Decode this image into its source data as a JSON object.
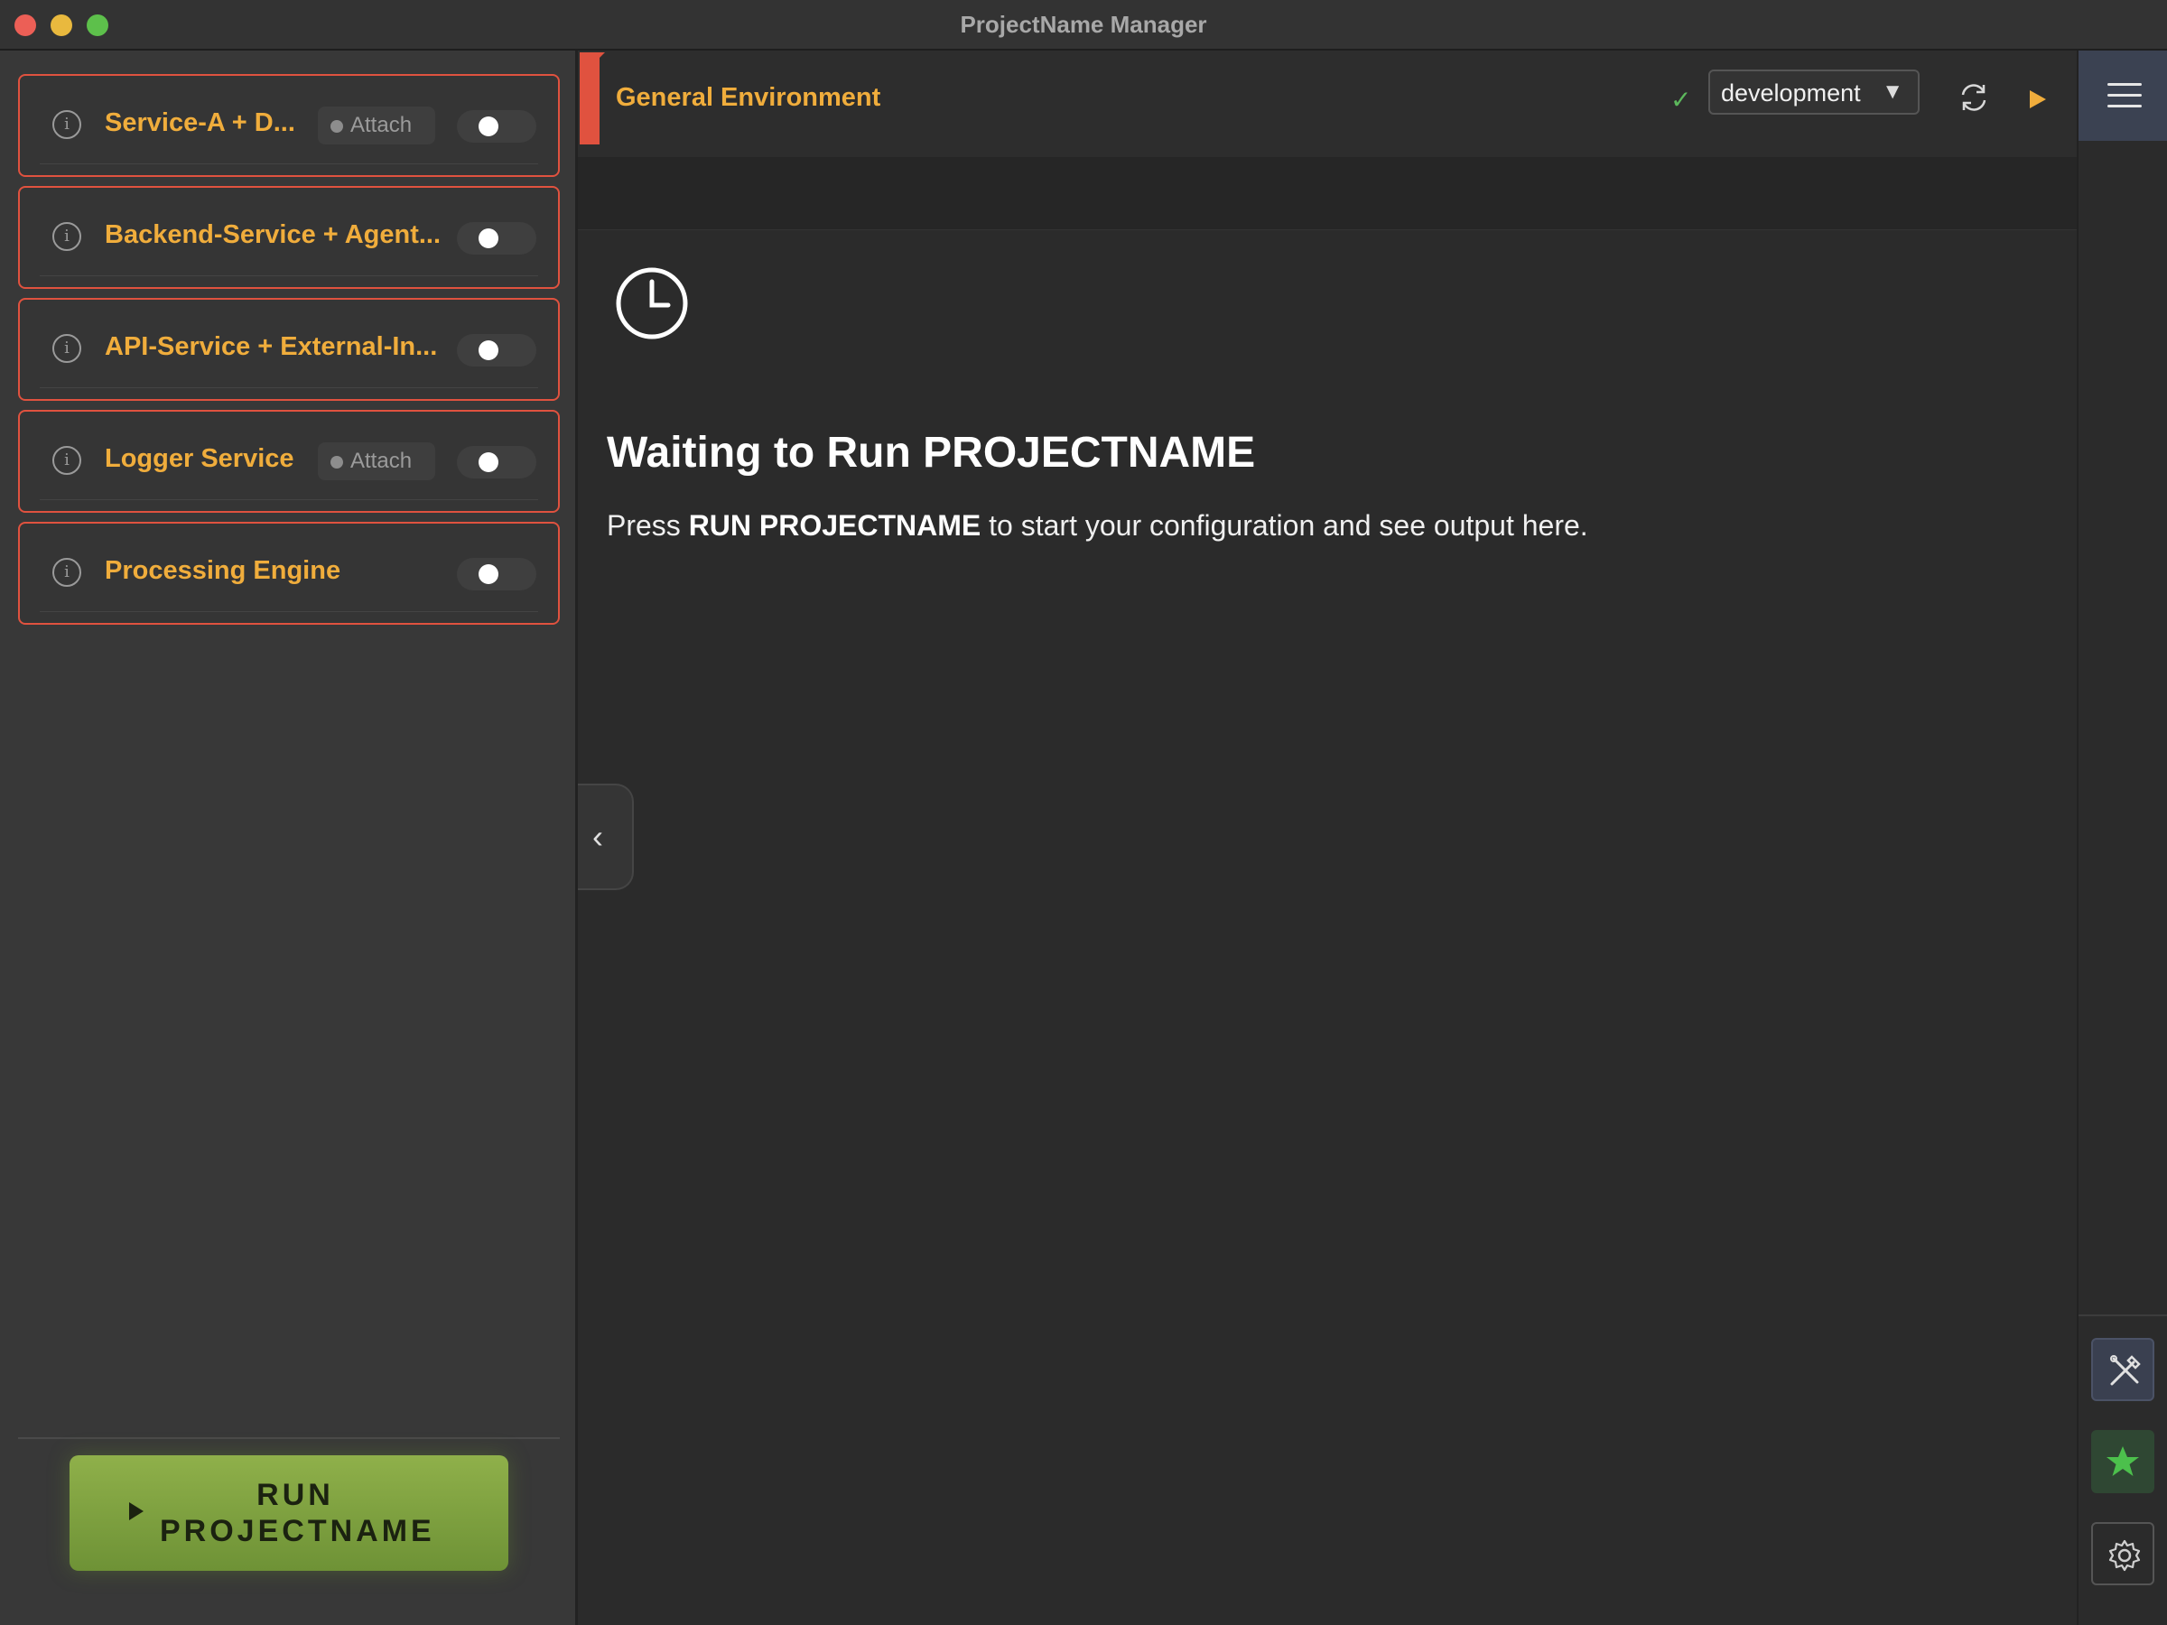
{
  "window": {
    "title": "ProjectName Manager"
  },
  "sidebar": {
    "services": [
      {
        "name": "Service-A + D...",
        "has_attach": true,
        "attach_label": "Attach",
        "enabled": false
      },
      {
        "name": "Backend-Service + Agent...",
        "has_attach": false,
        "enabled": false
      },
      {
        "name": "API-Service + External-In...",
        "has_attach": false,
        "enabled": false
      },
      {
        "name": "Logger Service",
        "has_attach": true,
        "attach_label": "Attach",
        "enabled": false
      },
      {
        "name": "Processing Engine",
        "has_attach": false,
        "enabled": false
      }
    ],
    "run_button": {
      "line1": "RUN",
      "line2": "PROJECTNAME"
    }
  },
  "header": {
    "environment_title": "General Environment",
    "status_check": "✓",
    "environment_select": {
      "value": "development",
      "caret": "▼"
    }
  },
  "main": {
    "status_title": "Waiting to Run PROJECTNAME",
    "desc_prefix": "Press ",
    "desc_bold": "RUN PROJECTNAME",
    "desc_suffix": " to start your configuration and see output here.",
    "collapse_glyph": "‹"
  },
  "icons": {
    "info": "info-icon",
    "refresh": "refresh-icon",
    "play": "play-icon",
    "clock": "clock-icon",
    "menu": "hamburger-menu-icon",
    "tools": "tools-icon",
    "star": "star-icon",
    "gear": "gear-icon"
  },
  "colors": {
    "accent_orange": "#f0ad3c",
    "border_red": "#e0523f",
    "run_green": "#7fa23f",
    "check_green": "#5cb85c"
  }
}
